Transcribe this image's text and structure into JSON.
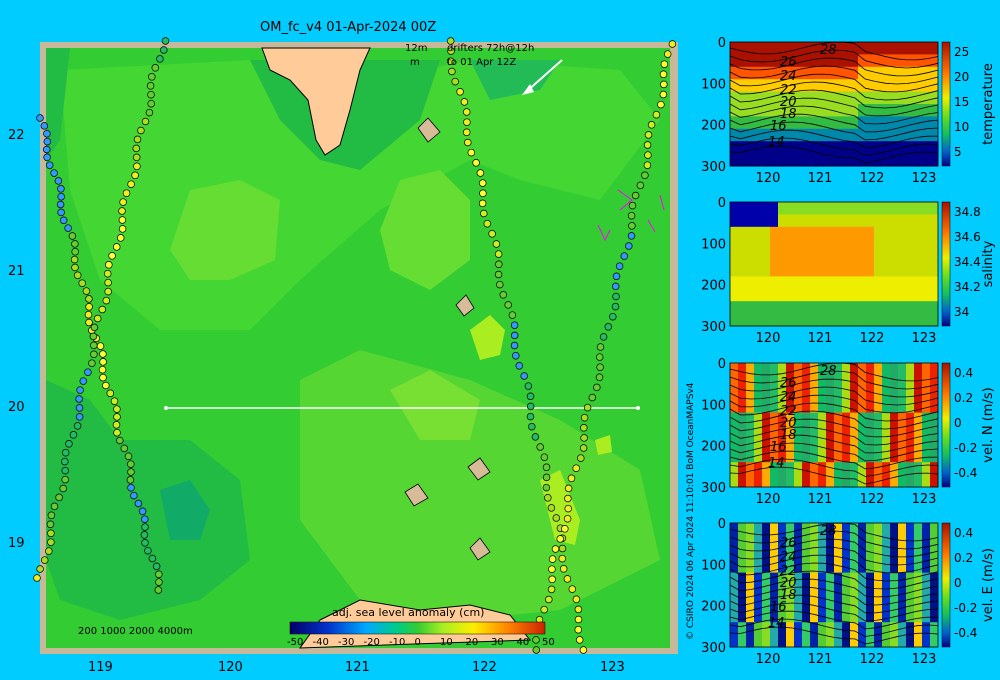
{
  "title": "OM_fc_v4  01-Apr-2024 00Z",
  "drifter_label_1": "12m",
  "drifter_label_2": "drifters 72h@12h",
  "drifter_label_3": "m",
  "drifter_label_4": "to 01 Apr 12Z",
  "map": {
    "lat_ticks": [
      "22",
      "21",
      "20",
      "19"
    ],
    "lon_ticks": [
      "119",
      "120",
      "121",
      "122",
      "123"
    ],
    "depth_legend": "200  1000  2000  4000m",
    "colorbar_title": "adj. sea level anomaly (cm)",
    "colorbar_ticks": [
      "-50",
      "-40",
      "-30",
      "-20",
      "-10",
      "0",
      "10",
      "20",
      "30",
      "40",
      "50"
    ]
  },
  "credit": "© CSIRO 2024   06 Apr 2024 11:10:01 BoM OceanMAPSv4",
  "panels": [
    {
      "name": "temperature",
      "ylabel": "temperature",
      "cbar_ticks": [
        "25",
        "20",
        "15",
        "10",
        "5"
      ],
      "contours": [
        "28",
        "26",
        "24",
        "22",
        "20",
        "18",
        "16",
        "14"
      ]
    },
    {
      "name": "salinity",
      "ylabel": "salinity",
      "cbar_ticks": [
        "34.8",
        "34.6",
        "34.4",
        "34.2",
        "34"
      ],
      "contours": []
    },
    {
      "name": "vel-n",
      "ylabel": "vel. N (m/s)",
      "cbar_ticks": [
        "0.4",
        "0.2",
        "0",
        "-0.2",
        "-0.4"
      ],
      "contours": [
        "28",
        "26",
        "24",
        "22",
        "20",
        "18",
        "16",
        "14"
      ]
    },
    {
      "name": "vel-e",
      "ylabel": "vel. E (m/s)",
      "cbar_ticks": [
        "0.4",
        "0.2",
        "0",
        "-0.2",
        "-0.4"
      ],
      "contours": [
        "28",
        "26",
        "24",
        "22",
        "20",
        "18",
        "16",
        "14"
      ]
    }
  ],
  "section_x_ticks": [
    "120",
    "121",
    "122",
    "123"
  ],
  "section_y_ticks": [
    "0",
    "100",
    "200",
    "300"
  ]
}
